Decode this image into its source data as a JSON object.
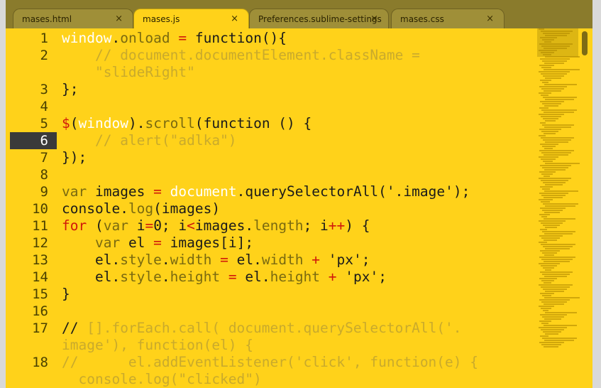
{
  "tabs": [
    {
      "label": "mases.html",
      "close": "×"
    },
    {
      "label": "mases.js",
      "close": "×"
    },
    {
      "label": "Preferences.sublime-settings",
      "close": "×"
    },
    {
      "label": "mases.css",
      "close": "×"
    }
  ],
  "code": {
    "line_numbers": [
      "1",
      "2",
      "3",
      "4",
      "5",
      "6",
      "7",
      "8",
      "9",
      "10",
      "11",
      "12",
      "13",
      "14",
      "15",
      "16",
      "17",
      "18"
    ],
    "current_line": "6"
  },
  "colors": {
    "background": "#ffd21a",
    "keyword": "#d0180a",
    "builtin": "#ffffff",
    "property": "#7a6a10",
    "comment": "#c9aa2c"
  },
  "icons": [
    "close-icon"
  ]
}
